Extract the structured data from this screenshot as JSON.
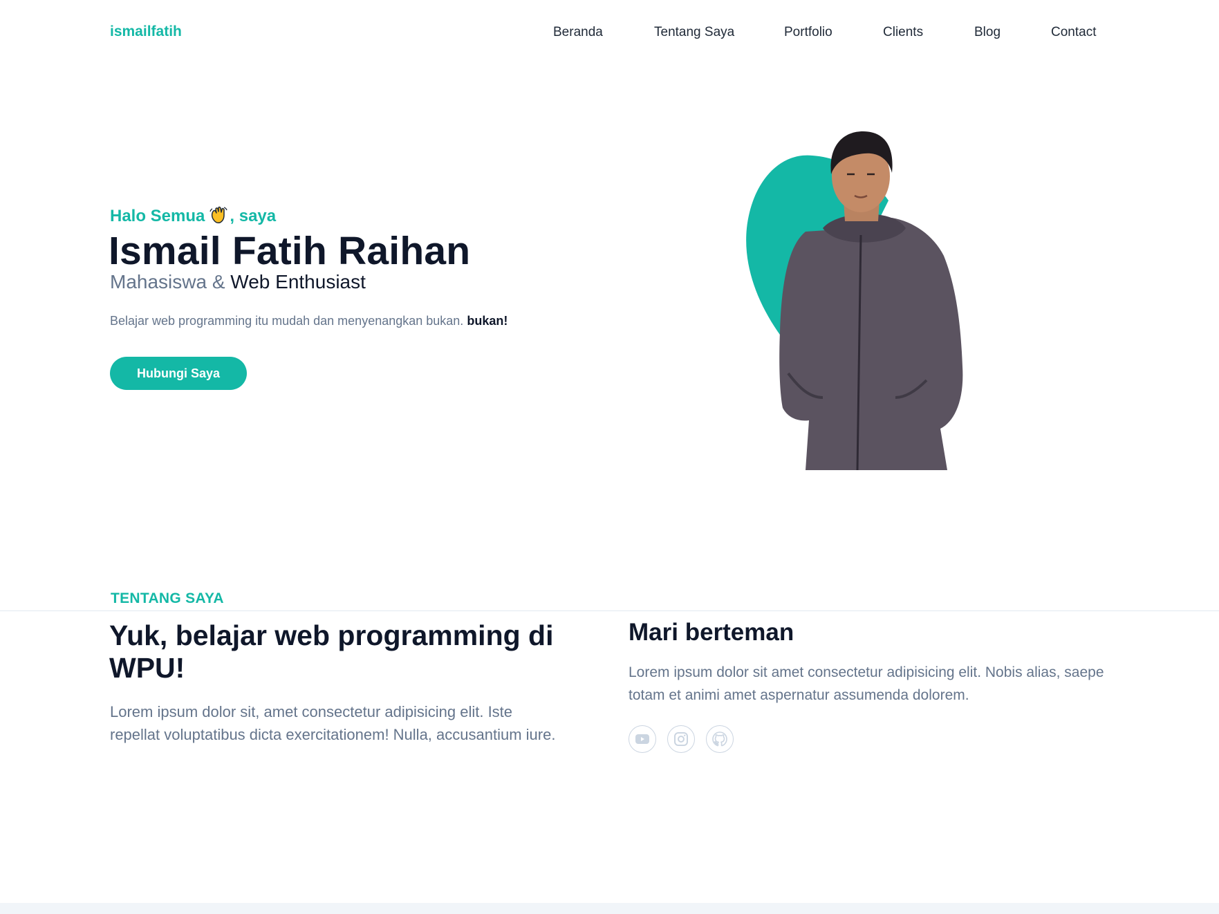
{
  "header": {
    "brand": "ismailfatih",
    "nav": [
      "Beranda",
      "Tentang Saya",
      "Portfolio",
      "Clients",
      "Blog",
      "Contact"
    ]
  },
  "hero": {
    "greeting_before": "Halo Semua",
    "greeting_icon": "waving-hand-icon",
    "greeting_after": ", saya",
    "name": "Ismail Fatih Raihan",
    "role_prefix": "Mahasiswa &",
    "role_accent": "Web Enthusiast",
    "description": "Belajar web programming itu mudah dan menyenangkan bukan.",
    "description_bold": "bukan!",
    "cta_label": "Hubungi Saya"
  },
  "about": {
    "section_label": "TENTANG SAYA",
    "title": "Yuk, belajar web programming di WPU!",
    "text": "Lorem ipsum dolor sit, amet consectetur adipisicing elit. Iste repellat voluptatibus dicta exercitationem! Nulla, accusantium iure.",
    "friends_title": "Mari berteman",
    "friends_text": "Lorem ipsum dolor sit amet consectetur adipisicing elit. Nobis alias, saepe totam et animi amet aspernatur assumenda dolorem.",
    "social_icons": [
      "youtube-icon",
      "instagram-icon",
      "github-icon"
    ]
  },
  "colors": {
    "primary": "#14b8a6",
    "dark": "#0f172a",
    "muted": "#64748b",
    "hoodie": "#5b5360"
  }
}
